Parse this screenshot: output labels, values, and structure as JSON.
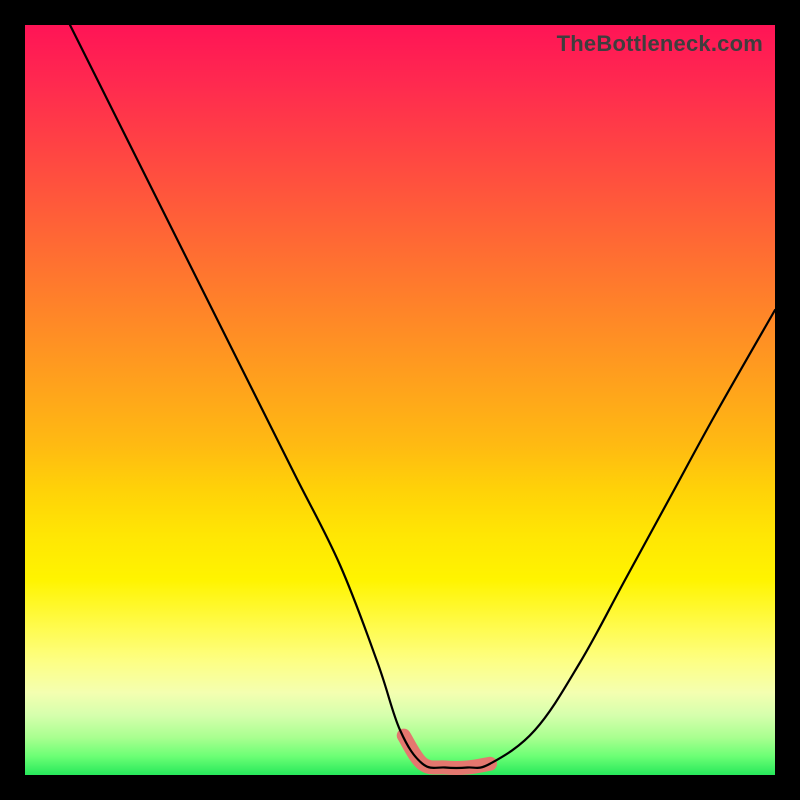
{
  "watermark": "TheBottleneck.com",
  "colors": {
    "frame": "#000000",
    "curve": "#000000",
    "band": "#e4776f"
  },
  "chart_data": {
    "type": "line",
    "title": "",
    "xlabel": "",
    "ylabel": "",
    "xlim": [
      0,
      100
    ],
    "ylim": [
      0,
      100
    ],
    "grid": false,
    "series": [
      {
        "name": "bottleneck-curve",
        "x": [
          6,
          12,
          18,
          24,
          30,
          36,
          42,
          47,
          50,
          53,
          56,
          59,
          62,
          68,
          74,
          80,
          86,
          92,
          100
        ],
        "y": [
          100,
          88,
          76,
          64,
          52,
          40,
          28,
          15,
          6,
          1.5,
          1,
          1,
          1.5,
          6,
          15,
          26,
          37,
          48,
          62
        ]
      }
    ],
    "annotations": [
      {
        "name": "valley-band",
        "x_range": [
          50.5,
          62
        ],
        "y": 1
      }
    ]
  }
}
